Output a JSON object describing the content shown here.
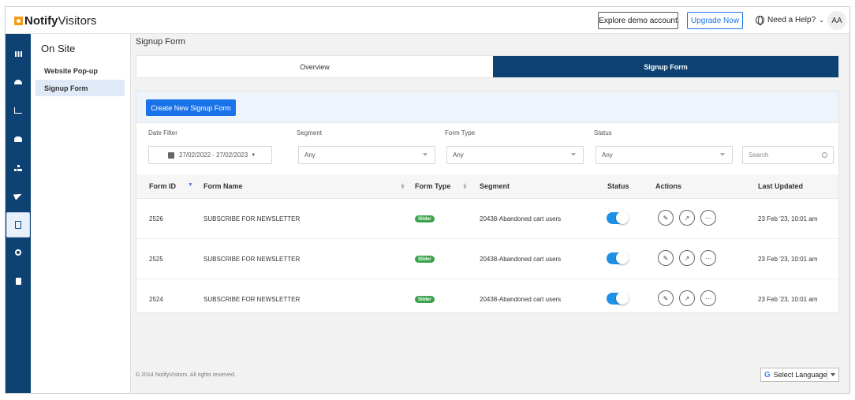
{
  "app": {
    "logo_bold": "Notify",
    "logo_rest": "Visitors"
  },
  "topbar": {
    "demo_label": "Explore demo account",
    "upgrade_label": "Upgrade Now",
    "help_label": "Need a Help?",
    "avatar_initials": "AA"
  },
  "rail": {
    "items": [
      "apps-icon",
      "dashboard-icon",
      "analytics-icon",
      "users-icon",
      "hierarchy-icon",
      "send-icon",
      "form-icon",
      "settings-icon",
      "document-icon"
    ],
    "active": "form-icon"
  },
  "submenu": {
    "title": "On Site",
    "items": [
      {
        "label": "Website Pop-up",
        "active": false
      },
      {
        "label": "Signup Form",
        "active": true
      }
    ]
  },
  "main": {
    "title": "Signup Form",
    "tabs": [
      {
        "label": "Overview",
        "active": false
      },
      {
        "label": "Signup Form",
        "active": true
      }
    ],
    "create_button": "Create New Signup Form"
  },
  "filters": {
    "date": {
      "label": "Date Filter",
      "value": "27/02/2022 - 27/02/2023"
    },
    "segment": {
      "label": "Segment",
      "value": "Any"
    },
    "form_type": {
      "label": "Form Type",
      "value": "Any"
    },
    "status": {
      "label": "Status",
      "value": "Any"
    },
    "search": {
      "placeholder": "Search"
    }
  },
  "table": {
    "columns": [
      "Form ID",
      "Form Name",
      "Form Type",
      "Segment",
      "Status",
      "Actions",
      "Last Updated"
    ],
    "rows": [
      {
        "id": "2526",
        "name": "SUBSCRIBE FOR NEWSLETTER",
        "type": "Slider",
        "segment": "20438-Abandoned cart users",
        "status_on": true,
        "updated": "23 Feb '23, 10:01 am"
      },
      {
        "id": "2525",
        "name": "SUBSCRIBE FOR NEWSLETTER",
        "type": "Slider",
        "segment": "20438-Abandoned cart users",
        "status_on": true,
        "updated": "23 Feb '23, 10:01 am"
      },
      {
        "id": "2524",
        "name": "SUBSCRIBE FOR NEWSLETTER",
        "type": "Slider",
        "segment": "20438-Abandoned cart users",
        "status_on": true,
        "updated": "23 Feb '23, 10:01 am"
      }
    ]
  },
  "footer": {
    "copyright": "© 2014 NotifyVisitors. All rights reserved.",
    "language_label": "Select Language",
    "language_brand": "G"
  },
  "colors": {
    "primary": "#0d4272",
    "accent": "#1a73e8",
    "badge_green": "#3aa34b",
    "toggle_on": "#1e90e8"
  }
}
